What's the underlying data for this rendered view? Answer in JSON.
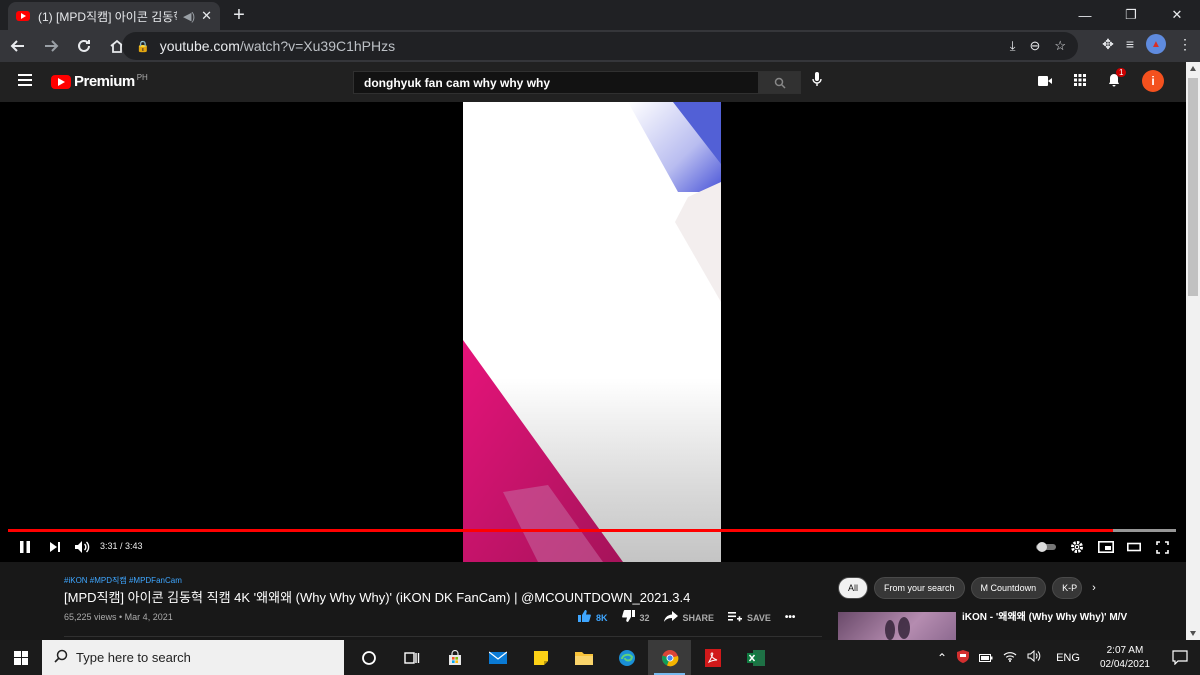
{
  "browser": {
    "tab_title": "(1) [MPD직캠] 아이콘 김동혁",
    "url_domain": "youtube.com",
    "url_path": "/watch?v=Xu39C1hPHzs",
    "window_controls": [
      "—",
      "❐",
      "✕"
    ]
  },
  "youtube": {
    "logo_word": "Premium",
    "region": "PH",
    "search_query": "donghyuk fan cam why why why",
    "notification_count": "1",
    "avatar_letter": "i"
  },
  "player": {
    "current_time": "3:31",
    "duration": "3:43",
    "time_display": "3:31 / 3:43",
    "progress_fraction": 0.946,
    "buffered_fraction": 1.0
  },
  "video": {
    "hashtags": "#iKON #MPD직캠 #MPDFanCam",
    "title": "[MPD직캠] 아이콘 김동혁 직캠 4K '왜왜왜 (Why Why Why)' (iKON DK FanCam) | @MCOUNTDOWN_2021.3.4",
    "meta": "65,225 views • Mar 4, 2021",
    "likes": "8K",
    "dislikes": "32",
    "share_label": "SHARE",
    "save_label": "SAVE",
    "more_label": "•••"
  },
  "chips": [
    "All",
    "From your search",
    "M Countdown",
    "K-P"
  ],
  "recommended": {
    "title": "iKON - '왜왜왜 (Why Why Why)' M/V"
  },
  "taskbar": {
    "search_placeholder": "Type here to search",
    "language": "ENG",
    "time": "2:07 AM",
    "date": "02/04/2021"
  },
  "colors": {
    "yt_red": "#ff0000",
    "link_blue": "#3ea6ff",
    "chrome_dark": "#202124"
  }
}
